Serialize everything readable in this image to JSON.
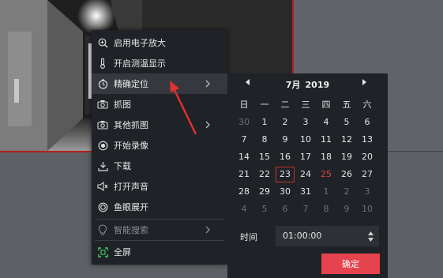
{
  "menu": {
    "items": [
      {
        "label": "启用电子放大",
        "icon": "zoom-in-icon",
        "state": "normal"
      },
      {
        "label": "开启测温显示",
        "icon": "thermometer-icon",
        "state": "normal"
      },
      {
        "label": "精确定位",
        "icon": "clock-icon",
        "state": "active",
        "submenu": true
      },
      {
        "label": "抓图",
        "icon": "camera-icon",
        "state": "normal"
      },
      {
        "label": "其他抓图",
        "icon": "camera-icon",
        "state": "normal",
        "submenu": true
      },
      {
        "label": "开始录像",
        "icon": "record-icon",
        "state": "normal"
      },
      {
        "label": "下载",
        "icon": "download-icon",
        "state": "normal"
      },
      {
        "label": "打开声音",
        "icon": "speaker-icon",
        "state": "normal"
      },
      {
        "label": "鱼眼展开",
        "icon": "fisheye-icon",
        "state": "normal"
      },
      {
        "label": "智能搜索",
        "icon": "lightbulb-icon",
        "state": "disabled",
        "submenu": true
      },
      {
        "label": "全屏",
        "icon": "fullscreen-icon",
        "state": "normal"
      }
    ]
  },
  "calendar": {
    "month_label": "7月",
    "year_label": "2019",
    "weekdays": [
      "日",
      "一",
      "二",
      "三",
      "四",
      "五",
      "六"
    ],
    "weeks": [
      [
        {
          "d": "30",
          "o": true
        },
        {
          "d": "1"
        },
        {
          "d": "2"
        },
        {
          "d": "3"
        },
        {
          "d": "4"
        },
        {
          "d": "5"
        },
        {
          "d": "6"
        }
      ],
      [
        {
          "d": "7"
        },
        {
          "d": "8"
        },
        {
          "d": "9"
        },
        {
          "d": "10"
        },
        {
          "d": "11"
        },
        {
          "d": "12"
        },
        {
          "d": "13"
        }
      ],
      [
        {
          "d": "14"
        },
        {
          "d": "15"
        },
        {
          "d": "16"
        },
        {
          "d": "17"
        },
        {
          "d": "18"
        },
        {
          "d": "19"
        },
        {
          "d": "20"
        }
      ],
      [
        {
          "d": "21"
        },
        {
          "d": "22"
        },
        {
          "d": "23",
          "sel": true
        },
        {
          "d": "24"
        },
        {
          "d": "25",
          "today": true
        },
        {
          "d": "26"
        },
        {
          "d": "27"
        }
      ],
      [
        {
          "d": "28"
        },
        {
          "d": "29"
        },
        {
          "d": "30"
        },
        {
          "d": "31"
        },
        {
          "d": "1",
          "o": true
        },
        {
          "d": "2",
          "o": true
        },
        {
          "d": "3",
          "o": true
        }
      ],
      [
        {
          "d": "4",
          "o": true
        },
        {
          "d": "5",
          "o": true
        },
        {
          "d": "6",
          "o": true
        },
        {
          "d": "7",
          "o": true
        },
        {
          "d": "8",
          "o": true
        },
        {
          "d": "9",
          "o": true
        },
        {
          "d": "10",
          "o": true
        }
      ]
    ],
    "time_label": "时间",
    "time_value": "01:00:00",
    "confirm_label": "确定"
  },
  "colors": {
    "accent": "#e5434d",
    "selected_border": "#c0392b",
    "today_text": "#e04545",
    "pointer": "#e53030",
    "menu_bg": "#1f2226"
  }
}
